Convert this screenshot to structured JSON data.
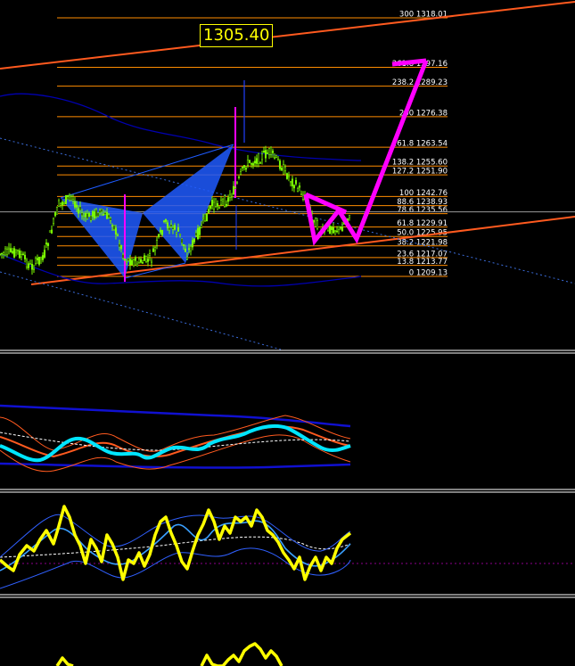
{
  "price_box": {
    "label": "1305.40"
  },
  "fib_levels": [
    {
      "ratio": "300",
      "price": "1318.01"
    },
    {
      "ratio": "261.8",
      "price": "1297.16"
    },
    {
      "ratio": "238.2",
      "price": "1289.23"
    },
    {
      "ratio": "200",
      "price": "1276.38"
    },
    {
      "ratio": "161.8",
      "price": "1263.54"
    },
    {
      "ratio": "138.2",
      "price": "1255.60"
    },
    {
      "ratio": "127.2",
      "price": "1251.90"
    },
    {
      "ratio": "100",
      "price": "1242.76"
    },
    {
      "ratio": "88.6",
      "price": "1238.93"
    },
    {
      "ratio": "78.6",
      "price": "1235.56"
    },
    {
      "ratio": "61.8",
      "price": "1229.91"
    },
    {
      "ratio": "50.0",
      "price": "1225.95"
    },
    {
      "ratio": "38.2",
      "price": "1221.98"
    },
    {
      "ratio": "23.6",
      "price": "1217.07"
    },
    {
      "ratio": "13.8",
      "price": "1213.77"
    },
    {
      "ratio": "0",
      "price": "1209.13"
    }
  ],
  "colors": {
    "background": "#000000",
    "fib_line": "#ff8c00",
    "trend_line": "#ff5a1f",
    "harmonic_pattern": "#1e5bff",
    "projection": "#ff00ff",
    "candles": "#7cfc00",
    "price_box": "#ffff00",
    "oscillator_main": "#00e5ff",
    "oscillator_signal": "#ffff00"
  }
}
